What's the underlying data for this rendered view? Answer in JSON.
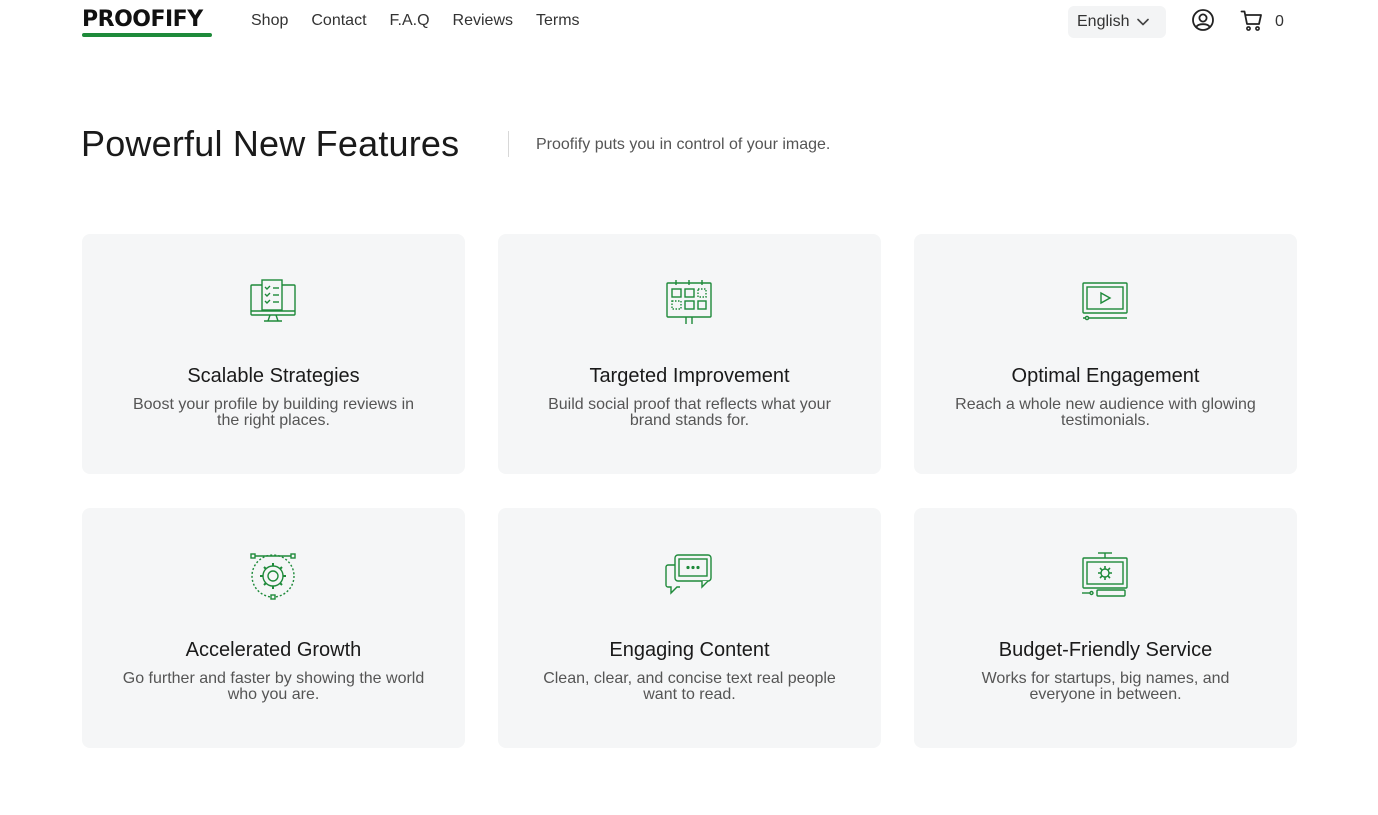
{
  "header": {
    "logo": {
      "text": "PROOFIFY"
    },
    "nav": [
      {
        "label": "Shop"
      },
      {
        "label": "Contact"
      },
      {
        "label": "F.A.Q"
      },
      {
        "label": "Reviews"
      },
      {
        "label": "Terms"
      }
    ],
    "language": {
      "selected": "English",
      "icon": "chevron-down-icon"
    },
    "user_icon": "user-circle-icon",
    "cart": {
      "icon": "cart-icon",
      "count": "0"
    }
  },
  "hero": {
    "title": "Powerful New Features",
    "subtitle": "Proofify puts you in control of your image."
  },
  "features": [
    {
      "title": "Scalable Strategies",
      "desc": "Boost your profile by building reviews in the right places.",
      "icon": "monitor-checklist-icon"
    },
    {
      "title": "Targeted Improvement",
      "desc": "Build social proof that reflects what your brand stands for.",
      "icon": "board-grid-icon"
    },
    {
      "title": "Optimal Engagement",
      "desc": "Reach a whole new audience with glowing testimonials.",
      "icon": "video-player-icon"
    },
    {
      "title": "Accelerated Growth",
      "desc": "Go further and faster by showing the world who you are.",
      "icon": "gear-vector-icon"
    },
    {
      "title": "Engaging Content",
      "desc": "Clean, clear, and concise text real people want to read.",
      "icon": "chat-bubbles-icon"
    },
    {
      "title": "Budget-Friendly Service",
      "desc": "Works for startups, big names, and everyone in between.",
      "icon": "monitor-gear-icon"
    }
  ],
  "colors": {
    "accent": "#1e8a3a",
    "card_bg": "#f5f6f7",
    "text": "#1a1a1a",
    "muted": "#555555"
  }
}
